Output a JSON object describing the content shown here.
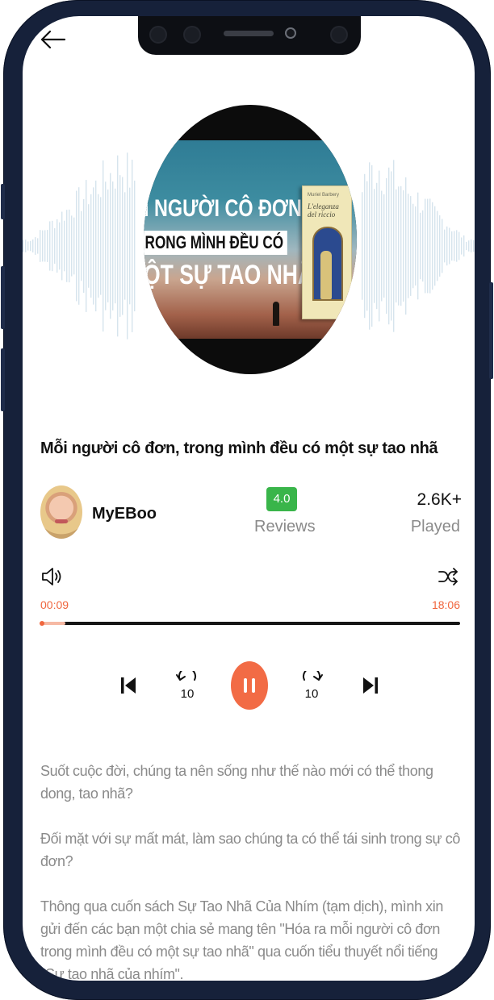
{
  "track": {
    "title": "Mỗi người cô đơn, trong mình đều có một sự tao nhã"
  },
  "cover": {
    "line1": "I NGƯỜI CÔ ĐƠN",
    "line2": "RONG MÌNH ĐỀU CÓ",
    "line3": "ỘT SỰ TAO NHÃ",
    "book_author": "Muriel Barbery",
    "book_title": "L'eleganza del riccio"
  },
  "author": {
    "name": "MyEBoo"
  },
  "stats": {
    "rating": "4.0",
    "reviews_label": "Reviews",
    "played_count": "2.6K+",
    "played_label": "Played"
  },
  "player": {
    "current_time": "00:09",
    "total_time": "18:06",
    "progress_fraction": 0.06,
    "rewind_label": "10",
    "forward_label": "10",
    "state": "playing"
  },
  "description": [
    "Suốt cuộc đời, chúng ta nên sống như thế nào mới có thể thong dong, tao nhã?",
    "Đối mặt với sự mất mát, làm sao chúng ta có thể tái sinh trong sự cô đơn?",
    "Thông qua cuốn sách Sự Tao Nhã Của Nhím (tạm dịch), mình xin gửi đến các bạn  một chia sẻ mang tên \"Hóa ra mỗi người cô đơn trong mình đều có một sự tao nhã\" qua cuốn tiểu thuyết nổi tiếng \"Sự tao nhã của nhím\"."
  ],
  "colors": {
    "accent": "#f26b45",
    "rating_badge": "#39b54a",
    "muted_text": "#8a8a8a",
    "frame": "#16213a"
  },
  "icons": {
    "back": "arrow-left-icon",
    "volume": "volume-icon",
    "shuffle": "shuffle-icon",
    "previous": "skip-previous-icon",
    "rewind": "rewind-10-icon",
    "pause": "pause-icon",
    "forward": "forward-10-icon",
    "next": "skip-next-icon"
  }
}
